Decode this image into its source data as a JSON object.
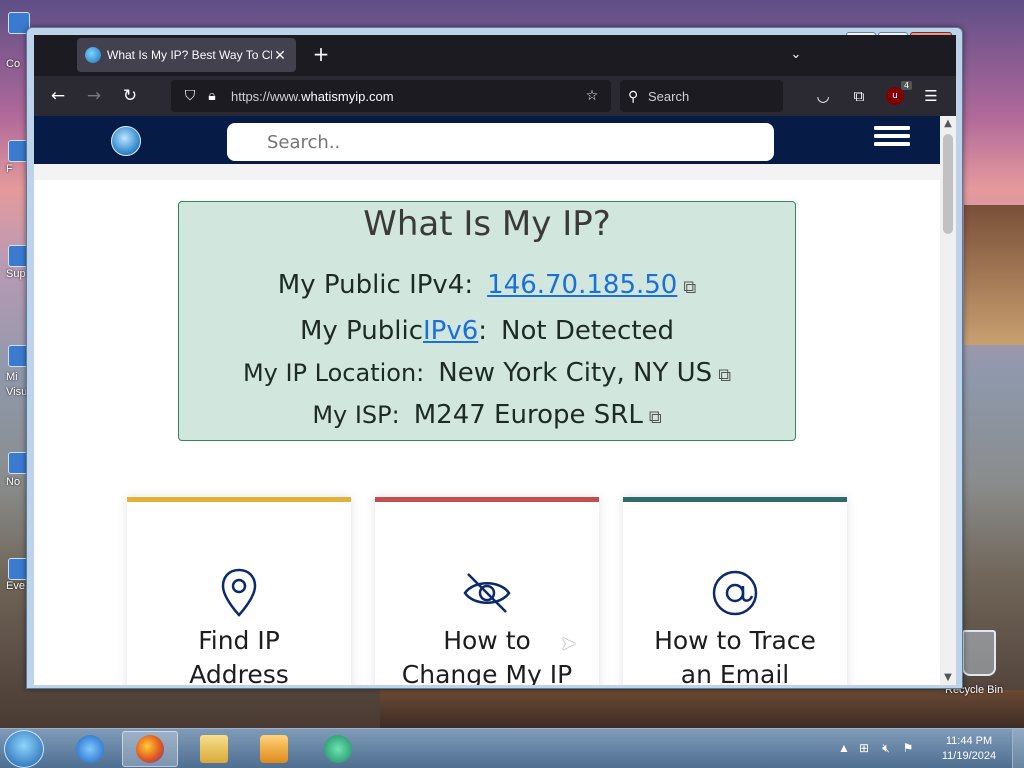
{
  "browser": {
    "tab_title": "What Is My IP? Best Way To Ch",
    "url_prefix": "https://www.",
    "url_domain": "whatismyip.com",
    "search_placeholder": "Search",
    "ublock_count": "4"
  },
  "site": {
    "search_placeholder": "Search.."
  },
  "ipbox": {
    "title": "What Is My IP?",
    "ipv4_label": "My Public IPv4:",
    "ipv4_value": "146.70.185.50",
    "ipv6_label_prefix": "My Public ",
    "ipv6_link": "IPv6",
    "ipv6_label_suffix": ":",
    "ipv6_value": "Not Detected",
    "location_label": "My IP Location:",
    "location_value": "New York City, NY US",
    "isp_label": "My ISP:",
    "isp_value": "M247 Europe SRL"
  },
  "cards": [
    {
      "label_line1": "Find IP",
      "label_line2": "Address",
      "accent": "#e0b23c",
      "icon": "location-pin-icon"
    },
    {
      "label_line1": "How to",
      "label_line2": "Change My IP",
      "accent": "#c0504d",
      "icon": "eye-slash-icon"
    },
    {
      "label_line1": "How to Trace",
      "label_line2": "an Email",
      "accent": "#2f6b6b",
      "icon": "at-sign-icon"
    }
  ],
  "desktop": {
    "icons": [
      "Co",
      "F",
      "Sup",
      "Mi",
      "Visu",
      "No",
      "Eve"
    ],
    "recycle_bin": "Recycle Bin"
  },
  "taskbar": {
    "time": "11:44 PM",
    "date": "11/19/2024"
  },
  "colors": {
    "site_header": "#061b45",
    "ipbox_bg": "#d1e7dd",
    "link": "#1a6fd9"
  }
}
